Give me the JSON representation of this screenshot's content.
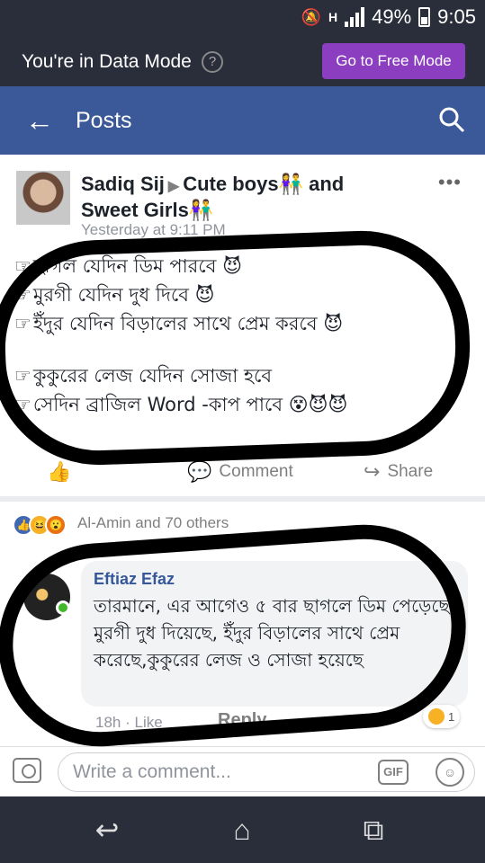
{
  "status_bar": {
    "network": "H",
    "battery": "49%",
    "time": "9:05"
  },
  "data_mode": {
    "message": "You're in Data Mode",
    "help": "?",
    "button": "Go to Free Mode"
  },
  "header": {
    "title": "Posts"
  },
  "post": {
    "author": "Sadiq Sij",
    "target": "Cute boys👫 and Sweet Girls👫",
    "time": "Yesterday at 9:11 PM",
    "lines": [
      "ছাগল যেদিন ডিম পারবে 😈",
      "মুরগী যেদিন দুধ দিবে 😈",
      "ইঁদুর যেদিন বিড়ালের সাথে প্রেম করবে 😈",
      "কুকুরের লেজ যেদিন সোজা হবে",
      "সেদিন ব্রাজিল Word -কাপ পাবে 😵😈😈"
    ],
    "comment_label": "Comment",
    "share_label": "Share"
  },
  "comments": {
    "reaction_summary": "Al-Amin and 70 others",
    "comment": {
      "name": "Eftiaz Efaz",
      "text": "তারমানে,  এর আগেও ৫ বার ছাগলে ডিম পেড়েছে,  মুরগী দুধ দিয়েছে, ইঁদুর বিড়ালের সাথে প্রেম করেছে,কুকুরের লেজ ও সোজা হয়েছে",
      "time": "18h",
      "like": "Like",
      "reply": "Reply",
      "reaction_count": "1"
    }
  },
  "composer": {
    "placeholder": "Write a comment...",
    "gif": "GIF"
  },
  "colors": {
    "facebook_blue": "#3b5998",
    "free_mode_purple": "#8b3fc0",
    "status_bg": "#2a2d3a"
  }
}
